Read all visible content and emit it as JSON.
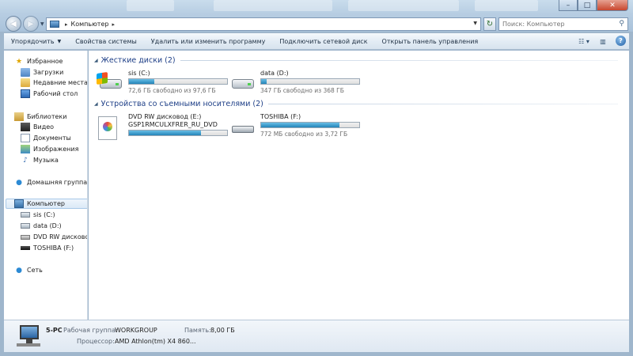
{
  "address": {
    "crumb": "Компьютер"
  },
  "search": {
    "placeholder": "Поиск: Компьютер"
  },
  "toolbar": {
    "organize": "Упорядочить",
    "system_properties": "Свойства системы",
    "uninstall": "Удалить или изменить программу",
    "map_drive": "Подключить сетевой диск",
    "control_panel": "Открыть панель управления"
  },
  "sidebar": {
    "favorites": "Избранное",
    "downloads": "Загрузки",
    "recent": "Недавние места",
    "desktop": "Рабочий стол",
    "libraries": "Библиотеки",
    "video": "Видео",
    "documents": "Документы",
    "images": "Изображения",
    "music": "Музыка",
    "homegroup": "Домашняя группа",
    "computer": "Компьютер",
    "drive_c": "sis (C:)",
    "drive_d": "data (D:)",
    "drive_e": "DVD RW дисковод (",
    "drive_f": "TOSHIBA (F:)",
    "network": "Сеть"
  },
  "groups": {
    "hdd": "Жесткие диски (2)",
    "removable": "Устройства со съемными носителями (2)"
  },
  "drives": {
    "c": {
      "name": "sis (C:)",
      "free": "72,6 ГБ свободно из 97,6 ГБ",
      "used_fraction": 0.26
    },
    "d": {
      "name": "data (D:)",
      "free": "347 ГБ свободно из 368 ГБ",
      "used_fraction": 0.06
    },
    "e": {
      "name": "DVD RW дисковод (E:)",
      "label": "GSP1RMCULXFRER_RU_DVD",
      "used_fraction": 0.73
    },
    "f": {
      "name": "TOSHIBA (F:)",
      "free": "772 МБ свободно из 3,72 ГБ",
      "used_fraction": 0.8
    }
  },
  "details": {
    "pc_name": "5-PC",
    "workgroup_label": "Рабочая группа:",
    "workgroup": "WORKGROUP",
    "memory_label": "Память:",
    "memory": "8,00 ГБ",
    "cpu_label": "Процессор:",
    "cpu": "AMD Athlon(tm) X4 860..."
  }
}
